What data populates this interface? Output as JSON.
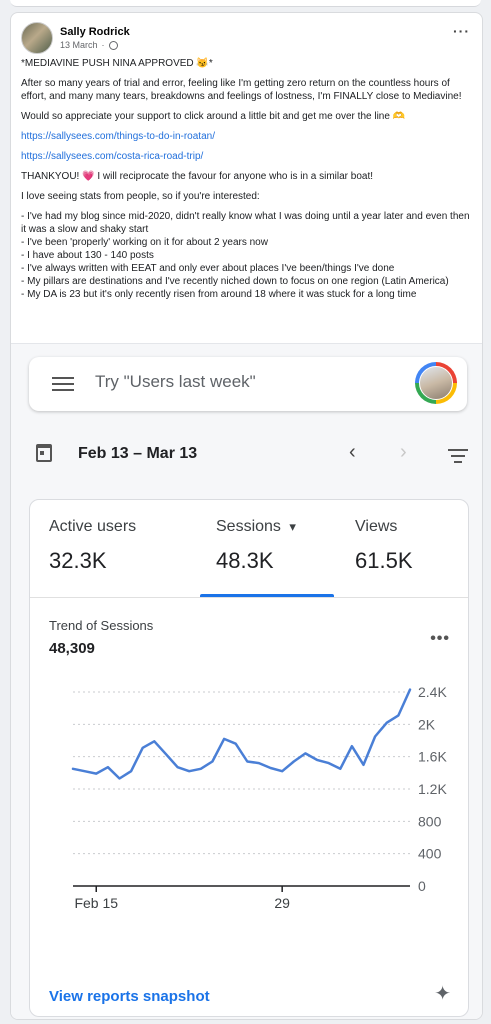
{
  "post": {
    "author": "Sally Rodrick",
    "date": "13 March",
    "separator": "·",
    "menu_glyph": "···",
    "paragraphs": [
      "*MEDIAVINE PUSH NINA APPROVED 😼*",
      "After so many years of trial and error, feeling like I'm getting zero return on the countless hours of effort, and many many tears, breakdowns and feelings of lostness, I'm FINALLY close to Mediavine!",
      "Would so appreciate your support to click around a little bit and get me over the line 🫶"
    ],
    "links": [
      "https://sallysees.com/things-to-do-in-roatan/",
      "https://sallysees.com/costa-rica-road-trip/"
    ],
    "thanks": "THANKYOU! 💗 I will reciprocate the favour for anyone who is in a similar boat!",
    "stats_intro": "I love seeing stats from people, so if you're interested:",
    "stats": [
      "- I've had my blog since mid-2020, didn't really know what I was doing until a year later and even then it was a slow and shaky start",
      "- I've been 'properly' working on it for about 2 years now",
      "- I have about 130 - 140 posts",
      "- I've always written with EEAT and only ever about places I've been/things I've done",
      "- My pillars are destinations and I've recently niched down to focus on one region (Latin America)",
      "- My DA is 23 but it's only recently risen from around 18 where it was stuck for a long time"
    ]
  },
  "analytics": {
    "search_placeholder": "Try \"Users last week\"",
    "date_range": "Feb 13 – Mar 13",
    "nav_prev": "‹",
    "nav_next": "›",
    "metrics": [
      {
        "label": "Active users",
        "value": "32.3K"
      },
      {
        "label": "Sessions",
        "value": "48.3K",
        "dropdown": "▾"
      },
      {
        "label": "Views",
        "value": "61.5K"
      }
    ],
    "trend_title": "Trend of Sessions",
    "trend_value": "48,309",
    "card_menu": "•••",
    "snapshot_link": "View reports snapshot",
    "sparkle_glyph": "✦"
  },
  "chart_data": {
    "type": "line",
    "x_tick_labels": [
      "Feb 15",
      "29"
    ],
    "y_tick_labels": [
      "0",
      "400",
      "800",
      "1.2K",
      "1.6K",
      "2K",
      "2.4K"
    ],
    "ylim": [
      0,
      2400
    ],
    "series": [
      {
        "values": [
          1450,
          1420,
          1390,
          1470,
          1330,
          1420,
          1710,
          1790,
          1630,
          1470,
          1420,
          1450,
          1540,
          1820,
          1760,
          1540,
          1520,
          1460,
          1420,
          1540,
          1640,
          1560,
          1520,
          1450,
          1730,
          1500,
          1850,
          2020,
          2110,
          2430
        ]
      }
    ],
    "line_color": "#4a7fd6",
    "grid": "dashed horizontal"
  }
}
